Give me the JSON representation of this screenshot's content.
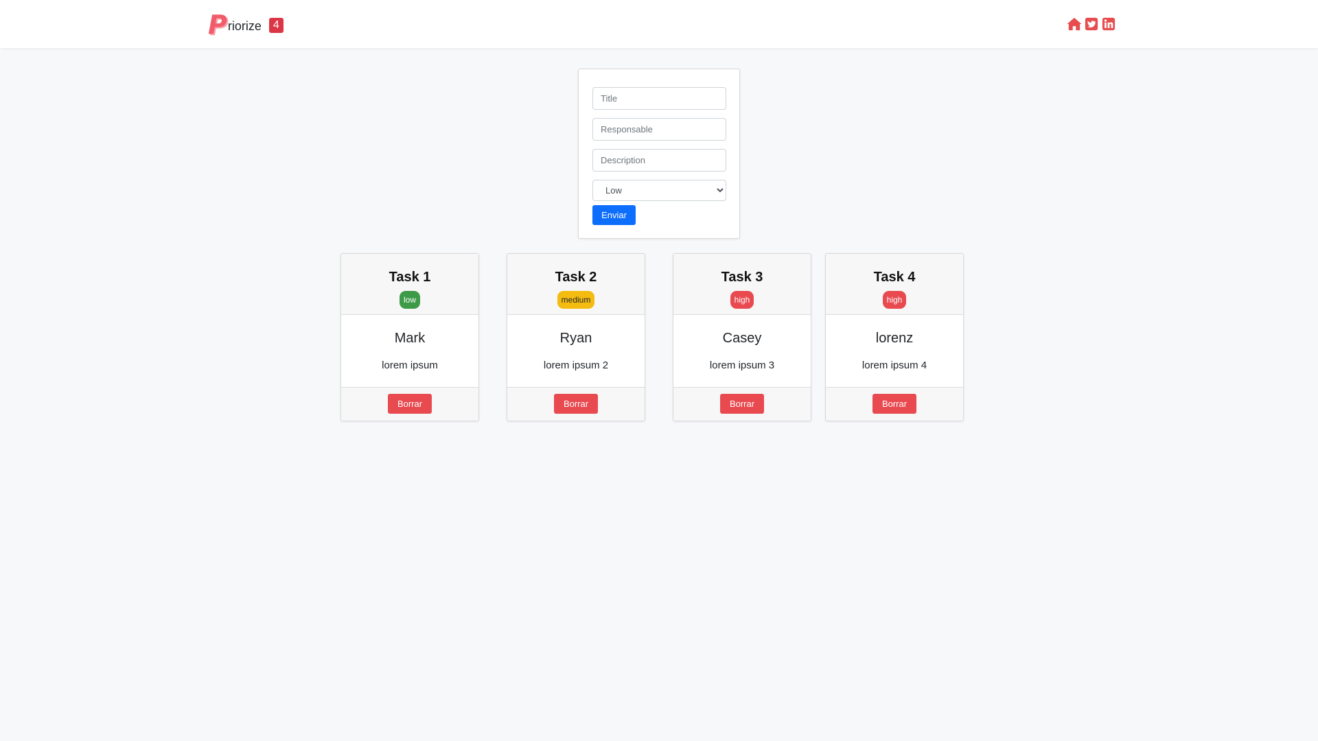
{
  "navbar": {
    "brand_logo": "P",
    "brand_text": "riorize",
    "task_count": "4",
    "icons": [
      "home-icon",
      "twitter-icon",
      "linkedin-icon"
    ],
    "accent_color": "#e74c4f"
  },
  "form": {
    "title_placeholder": "Title",
    "responsable_placeholder": "Responsable",
    "description_placeholder": "Description",
    "priority_selected": "Low",
    "priority_options": [
      "Low"
    ],
    "submit_label": "Enviar"
  },
  "tasks": [
    {
      "title": "Task 1",
      "priority": "low",
      "priority_color": "#3d9a47",
      "responsable": "Mark",
      "description": "lorem ipsum",
      "delete_label": "Borrar"
    },
    {
      "title": "Task 2",
      "priority": "medium",
      "priority_color": "#f4bb10",
      "responsable": "Ryan",
      "description": "lorem ipsum 2",
      "delete_label": "Borrar"
    },
    {
      "title": "Task 3",
      "priority": "high",
      "priority_color": "#e84a50",
      "responsable": "Casey",
      "description": "lorem ipsum 3",
      "delete_label": "Borrar"
    },
    {
      "title": "Task 4",
      "priority": "high",
      "priority_color": "#e84a50",
      "responsable": "lorenz",
      "description": "lorem ipsum 4",
      "delete_label": "Borrar"
    }
  ]
}
